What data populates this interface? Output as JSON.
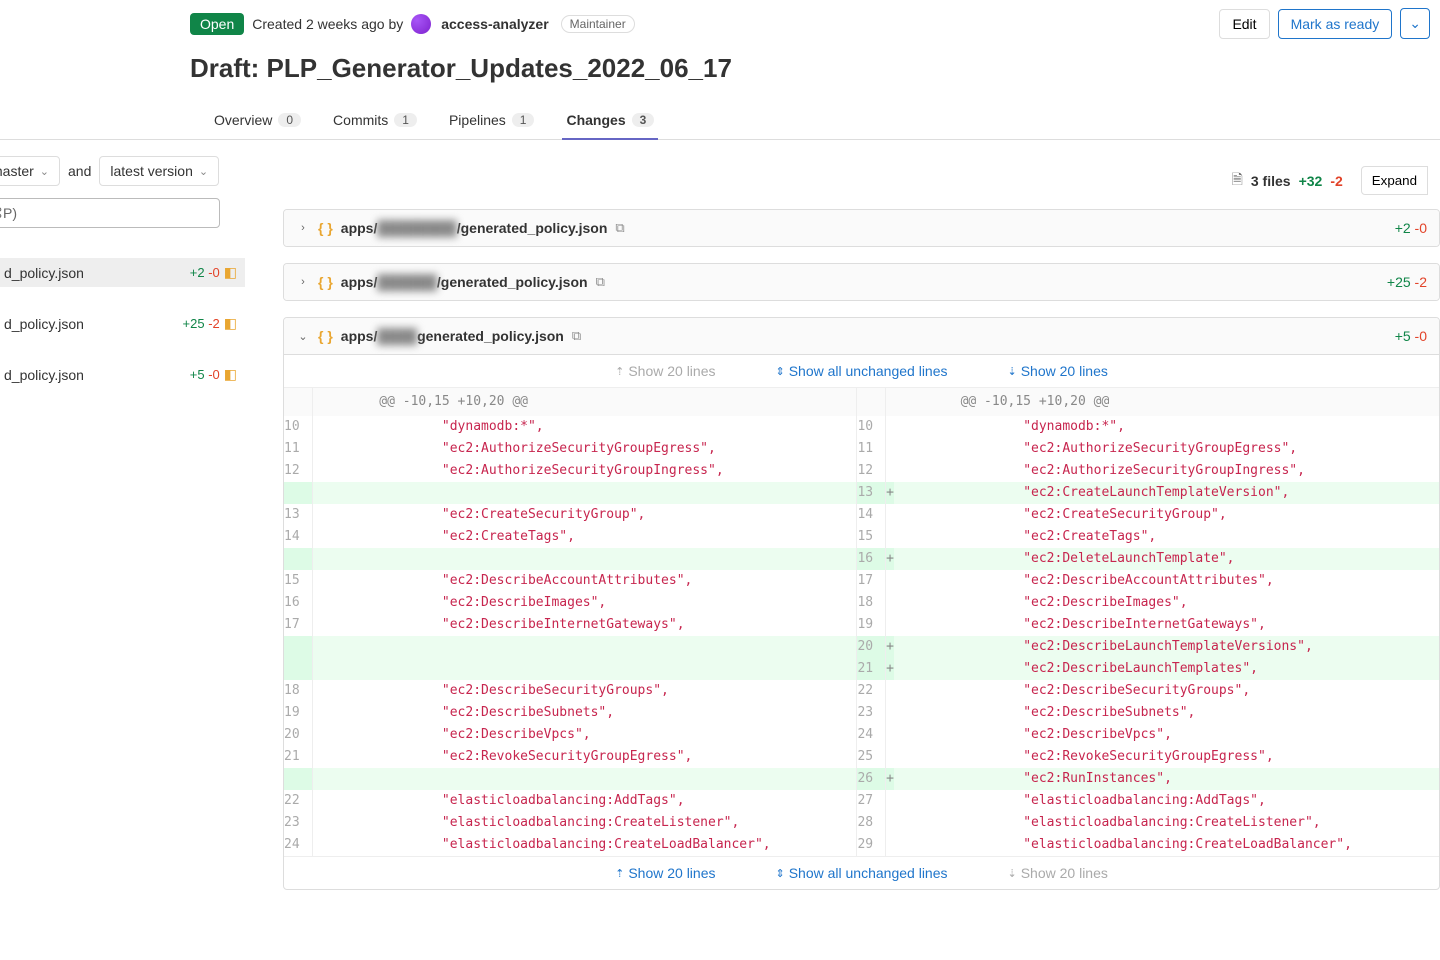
{
  "header": {
    "status": "Open",
    "created": "Created 2 weeks ago by",
    "author": "access-analyzer",
    "role": "Maintainer",
    "edit": "Edit",
    "mark_ready": "Mark as ready"
  },
  "title": "Draft: PLP_Generator_Updates_2022_06_17",
  "tabs": {
    "overview": "Overview",
    "overview_count": "0",
    "commits": "Commits",
    "commits_count": "1",
    "pipelines": "Pipelines",
    "pipelines_count": "1",
    "changes": "Changes",
    "changes_count": "3"
  },
  "versions": {
    "base": "master",
    "and": "and",
    "compare": "latest version"
  },
  "filter_placeholder": "⌘P)",
  "summary": {
    "files": "3 files",
    "add": "+32",
    "del": "-2",
    "expand": "Expand"
  },
  "tree": [
    {
      "name": "d_policy.json",
      "add": "+2",
      "del": "-0"
    },
    {
      "name": "d_policy.json",
      "add": "+25",
      "del": "-2"
    },
    {
      "name": "d_policy.json",
      "add": "+5",
      "del": "-0"
    }
  ],
  "files": [
    {
      "prefix": "apps/",
      "blur": "████████",
      "suffix": "/generated_policy.json",
      "add": "+2",
      "del": "-0",
      "expanded": false
    },
    {
      "prefix": "apps/",
      "blur": "██████",
      "suffix": "/generated_policy.json",
      "add": "+25",
      "del": "-2",
      "expanded": false
    },
    {
      "prefix": "apps/",
      "blur": "████",
      "suffix": "generated_policy.json",
      "add": "+5",
      "del": "-0",
      "expanded": true
    }
  ],
  "expand_labels": {
    "show20": "Show 20 lines",
    "showall": "Show all unchanged lines"
  },
  "diff": {
    "hunk": "@@ -10,15 +10,20 @@",
    "indent_ctx": "                ",
    "indent": "                ",
    "left": [
      {
        "n": "10",
        "t": "\"dynamodb:*\","
      },
      {
        "n": "11",
        "t": "\"ec2:AuthorizeSecurityGroupEgress\","
      },
      {
        "n": "12",
        "t": "\"ec2:AuthorizeSecurityGroupIngress\","
      },
      {
        "n": "",
        "t": ""
      },
      {
        "n": "13",
        "t": "\"ec2:CreateSecurityGroup\","
      },
      {
        "n": "14",
        "t": "\"ec2:CreateTags\","
      },
      {
        "n": "",
        "t": ""
      },
      {
        "n": "15",
        "t": "\"ec2:DescribeAccountAttributes\","
      },
      {
        "n": "16",
        "t": "\"ec2:DescribeImages\","
      },
      {
        "n": "17",
        "t": "\"ec2:DescribeInternetGateways\","
      },
      {
        "n": "",
        "t": ""
      },
      {
        "n": "",
        "t": ""
      },
      {
        "n": "18",
        "t": "\"ec2:DescribeSecurityGroups\","
      },
      {
        "n": "19",
        "t": "\"ec2:DescribeSubnets\","
      },
      {
        "n": "20",
        "t": "\"ec2:DescribeVpcs\","
      },
      {
        "n": "21",
        "t": "\"ec2:RevokeSecurityGroupEgress\","
      },
      {
        "n": "",
        "t": ""
      },
      {
        "n": "22",
        "t": "\"elasticloadbalancing:AddTags\","
      },
      {
        "n": "23",
        "t": "\"elasticloadbalancing:CreateListener\","
      },
      {
        "n": "24",
        "t": "\"elasticloadbalancing:CreateLoadBalancer\","
      }
    ],
    "right": [
      {
        "n": "10",
        "s": " ",
        "t": "\"dynamodb:*\","
      },
      {
        "n": "11",
        "s": " ",
        "t": "\"ec2:AuthorizeSecurityGroupEgress\","
      },
      {
        "n": "12",
        "s": " ",
        "t": "\"ec2:AuthorizeSecurityGroupIngress\","
      },
      {
        "n": "13",
        "s": "+",
        "t": "\"ec2:CreateLaunchTemplateVersion\",",
        "a": true
      },
      {
        "n": "14",
        "s": " ",
        "t": "\"ec2:CreateSecurityGroup\","
      },
      {
        "n": "15",
        "s": " ",
        "t": "\"ec2:CreateTags\","
      },
      {
        "n": "16",
        "s": "+",
        "t": "\"ec2:DeleteLaunchTemplate\",",
        "a": true
      },
      {
        "n": "17",
        "s": " ",
        "t": "\"ec2:DescribeAccountAttributes\","
      },
      {
        "n": "18",
        "s": " ",
        "t": "\"ec2:DescribeImages\","
      },
      {
        "n": "19",
        "s": " ",
        "t": "\"ec2:DescribeInternetGateways\","
      },
      {
        "n": "20",
        "s": "+",
        "t": "\"ec2:DescribeLaunchTemplateVersions\",",
        "a": true
      },
      {
        "n": "21",
        "s": "+",
        "t": "\"ec2:DescribeLaunchTemplates\",",
        "a": true
      },
      {
        "n": "22",
        "s": " ",
        "t": "\"ec2:DescribeSecurityGroups\","
      },
      {
        "n": "23",
        "s": " ",
        "t": "\"ec2:DescribeSubnets\","
      },
      {
        "n": "24",
        "s": " ",
        "t": "\"ec2:DescribeVpcs\","
      },
      {
        "n": "25",
        "s": " ",
        "t": "\"ec2:RevokeSecurityGroupEgress\","
      },
      {
        "n": "26",
        "s": "+",
        "t": "\"ec2:RunInstances\",",
        "a": true
      },
      {
        "n": "27",
        "s": " ",
        "t": "\"elasticloadbalancing:AddTags\","
      },
      {
        "n": "28",
        "s": " ",
        "t": "\"elasticloadbalancing:CreateListener\","
      },
      {
        "n": "29",
        "s": " ",
        "t": "\"elasticloadbalancing:CreateLoadBalancer\","
      }
    ]
  }
}
